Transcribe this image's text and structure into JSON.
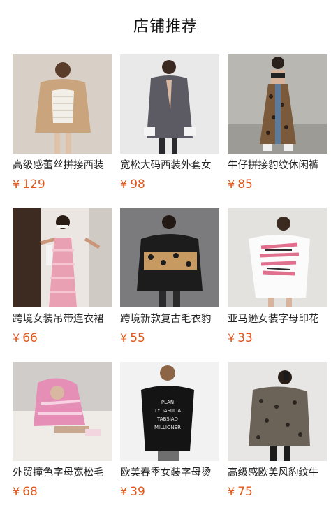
{
  "page": {
    "title": "店铺推荐"
  },
  "currency": "¥",
  "colors": {
    "price": "#e0561a",
    "title": "#111111",
    "text": "#222222"
  },
  "products": [
    {
      "name": "高级感蕾丝拼接西装",
      "price": "129",
      "image": "beige-corset-blazer"
    },
    {
      "name": "宽松大码西装外套女",
      "price": "98",
      "image": "grey-oversized-blazer"
    },
    {
      "name": "牛仔拼接豹纹休闲裤",
      "price": "85",
      "image": "leopard-denim-pants"
    },
    {
      "name": "跨境女装吊带连衣裙",
      "price": "66",
      "image": "pink-knit-slip-dress"
    },
    {
      "name": "跨境新款复古毛衣豹",
      "price": "55",
      "image": "black-leopard-sweater"
    },
    {
      "name": "亚马逊女装字母印花",
      "price": "33",
      "image": "white-letter-print-tee"
    },
    {
      "name": "外贸撞色字母宽松毛",
      "price": "68",
      "image": "pink-letter-hoodie"
    },
    {
      "name": "欧美春季女装字母烫",
      "price": "39",
      "image": "black-letter-print-tee"
    },
    {
      "name": "高级感欧美风豹纹牛",
      "price": "75",
      "image": "leopard-denim-jacket"
    }
  ]
}
